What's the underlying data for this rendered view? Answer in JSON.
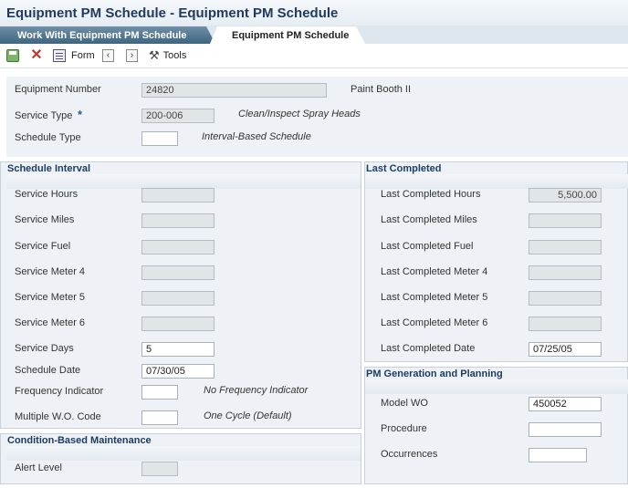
{
  "window": {
    "title": "Equipment PM Schedule - Equipment PM Schedule"
  },
  "tabs": [
    {
      "label": "Work With Equipment PM Schedule"
    },
    {
      "label": "Equipment PM Schedule"
    }
  ],
  "toolbar": {
    "form_label": "Form",
    "tools_label": "Tools",
    "icons": [
      "save-icon",
      "cancel-icon",
      "form-icon",
      "previous-icon",
      "next-icon",
      "tools-icon"
    ]
  },
  "header": {
    "equipment_number_label": "Equipment Number",
    "equipment_number_value": "24820",
    "equipment_description": "Paint Booth II",
    "service_type_label": "Service Type",
    "service_type_required": "*",
    "service_type_value": "200-006",
    "service_type_description": "Clean/Inspect Spray Heads",
    "schedule_type_label": "Schedule Type",
    "schedule_type_value": "",
    "schedule_type_description": "Interval-Based Schedule"
  },
  "schedule_interval": {
    "title": "Schedule Interval",
    "service_hours_label": "Service Hours",
    "service_hours_value": "",
    "service_miles_label": "Service Miles",
    "service_miles_value": "",
    "service_fuel_label": "Service Fuel",
    "service_fuel_value": "",
    "service_meter4_label": "Service Meter 4",
    "service_meter4_value": "",
    "service_meter5_label": "Service Meter 5",
    "service_meter5_value": "",
    "service_meter6_label": "Service Meter 6",
    "service_meter6_value": "",
    "service_days_label": "Service Days",
    "service_days_value": "5",
    "schedule_date_label": "Schedule Date",
    "schedule_date_value": "07/30/05",
    "frequency_indicator_label": "Frequency Indicator",
    "frequency_indicator_value": "",
    "frequency_indicator_description": "No Frequency Indicator",
    "multiple_wo_code_label": "Multiple W.O. Code",
    "multiple_wo_code_value": "",
    "multiple_wo_code_description": "One Cycle (Default)"
  },
  "last_completed": {
    "title": "Last Completed",
    "hours_label": "Last Completed Hours",
    "hours_value": "5,500.00",
    "miles_label": "Last Completed Miles",
    "miles_value": "",
    "fuel_label": "Last Completed Fuel",
    "fuel_value": "",
    "meter4_label": "Last Completed Meter 4",
    "meter4_value": "",
    "meter5_label": "Last Completed Meter 5",
    "meter5_value": "",
    "meter6_label": "Last Completed Meter 6",
    "meter6_value": "",
    "date_label": "Last Completed Date",
    "date_value": "07/25/05"
  },
  "pm_generation": {
    "title": "PM Generation and Planning",
    "model_wo_label": "Model WO",
    "model_wo_value": "450052",
    "procedure_label": "Procedure",
    "procedure_value": "",
    "occurrences_label": "Occurrences",
    "occurrences_value": ""
  },
  "condition_based": {
    "title": "Condition-Based Maintenance",
    "alert_level_label": "Alert Level",
    "alert_level_value": ""
  }
}
